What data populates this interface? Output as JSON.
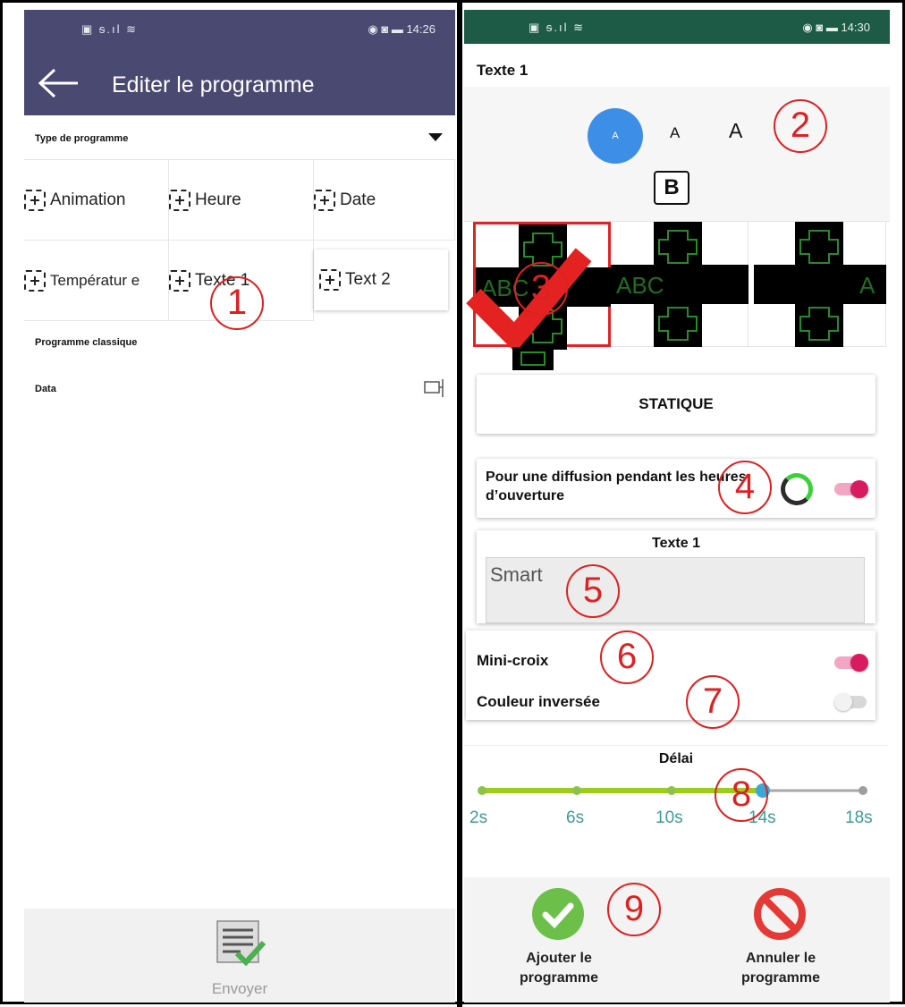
{
  "left": {
    "title": "Editer le programme",
    "status_time": "14:26",
    "type_label": "Type de programme",
    "program_types": [
      "Animation",
      "Heure",
      "Date",
      "Températur e",
      "Texte 1",
      "Text 2"
    ],
    "classic_label": "Programme classique",
    "data_label": "Data",
    "send_label": "Envoyer",
    "colors": {
      "appbar": "#4a4971"
    }
  },
  "right": {
    "status_time": "14:30",
    "title": "Texte 1",
    "font_sizes": [
      "A",
      "A",
      "A"
    ],
    "bold_label": "B",
    "thumbnail_text": "ABC",
    "static_label": "STATIQUE",
    "hours_label": "Pour une diffusion pendant les heures d’ouverture",
    "text_card_title": "Texte 1",
    "text_value": "Smart",
    "mini_cross_label": "Mini-croix",
    "mini_cross_on": true,
    "invert_label": "Couleur inversée",
    "invert_on": false,
    "delay_label": "Délai",
    "delay_ticks": [
      "2s",
      "6s",
      "10s",
      "14s",
      "18s"
    ],
    "delay_value": "14s",
    "add_label_1": "Ajouter le",
    "add_label_2": "programme",
    "cancel_label_1": "Annuler le",
    "cancel_label_2": "programme",
    "colors": {
      "statusbar": "#1d5b46",
      "accent": "#d81b60",
      "slider": "#9ccc1e",
      "tick_text": "#3e9a9b",
      "circle": "#3d8ee6"
    }
  },
  "annotations": [
    "1",
    "2",
    "3",
    "4",
    "5",
    "6",
    "7",
    "8",
    "9"
  ]
}
